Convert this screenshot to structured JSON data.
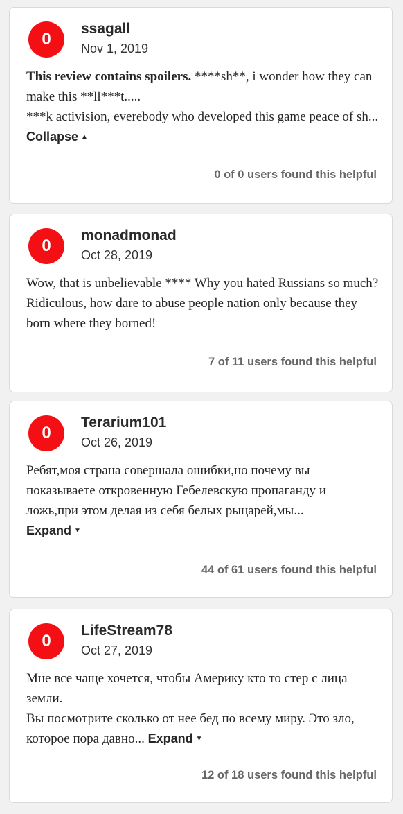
{
  "reviews": [
    {
      "score": "0",
      "username": "ssagall",
      "date": "Nov 1, 2019",
      "spoiler_label": "This review contains spoilers.",
      "text": " ****sh**, i wonder how they can make this **ll***t.....\n***k activision, everebody who developed this game peace of sh...",
      "toggle_label": "Collapse",
      "toggle_icon": "▲",
      "helpful": "0 of 0 users found this helpful"
    },
    {
      "score": "0",
      "username": "monadmonad",
      "date": "Oct 28, 2019",
      "spoiler_label": "",
      "text": "Wow, that is unbelievable **** Why you hated Russians so much? Ridiculous, how dare to abuse people nation only because they born where they borned!",
      "toggle_label": "",
      "toggle_icon": "",
      "helpful": "7 of 11 users found this helpful"
    },
    {
      "score": "0",
      "username": "Terarium101",
      "date": "Oct 26, 2019",
      "spoiler_label": "",
      "text": "Ребят,моя страна совершала ошибки,но почему вы показываете откровенную Гебелевскую пропаганду и ложь,при этом делая из себя белых рыцарей,мы...",
      "toggle_label": "Expand",
      "toggle_icon": "▼",
      "helpful": "44 of 61 users found this helpful"
    },
    {
      "score": "0",
      "username": "LifeStream78",
      "date": "Oct 27, 2019",
      "spoiler_label": "",
      "text": "Мне все чаще хочется, чтобы Америку кто то стер с лица земли.\nВы посмотрите сколько от нее бед по всему миру. Это зло, которое пора давно...",
      "toggle_label": "Expand",
      "toggle_icon": "▼",
      "helpful": "12 of 18 users found this helpful"
    }
  ],
  "colors": {
    "score_negative": "#f40f14",
    "helpful_text": "#666666"
  }
}
